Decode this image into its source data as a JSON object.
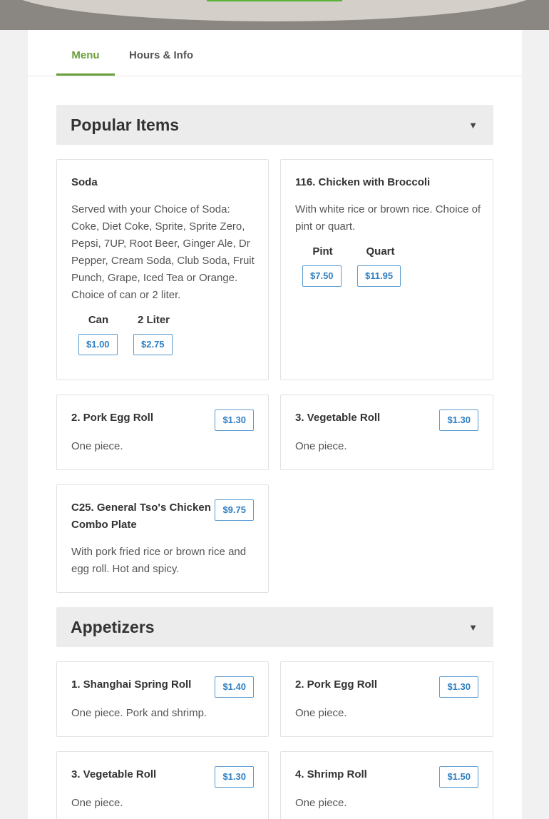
{
  "tabs": [
    {
      "label": "Menu",
      "active": true
    },
    {
      "label": "Hours & Info",
      "active": false
    }
  ],
  "sections": [
    {
      "title": "Popular Items",
      "items": [
        {
          "name": "Soda",
          "description": "Served with your Choice of Soda: Coke, Diet Coke, Sprite, Sprite Zero, Pepsi, 7UP, Root Beer, Ginger Ale, Dr Pepper, Cream Soda, Club Soda, Fruit Punch, Grape, Iced Tea or Orange. Choice of can or 2 liter.",
          "variants": [
            {
              "label": "Can",
              "price": "$1.00"
            },
            {
              "label": "2 Liter",
              "price": "$2.75"
            }
          ]
        },
        {
          "name": "116. Chicken with Broccoli",
          "description": "With white rice or brown rice. Choice of pint or quart.",
          "variants": [
            {
              "label": "Pint",
              "price": "$7.50"
            },
            {
              "label": "Quart",
              "price": "$11.95"
            }
          ]
        },
        {
          "name": "2. Pork Egg Roll",
          "description": "One piece.",
          "price": "$1.30"
        },
        {
          "name": "3. Vegetable Roll",
          "description": "One piece.",
          "price": "$1.30"
        },
        {
          "name": "C25. General Tso's Chicken Combo Plate",
          "description": "With pork fried rice or brown rice and egg roll. Hot and spicy.",
          "price": "$9.75"
        }
      ]
    },
    {
      "title": "Appetizers",
      "items": [
        {
          "name": "1. Shanghai Spring Roll",
          "description": "One piece. Pork and shrimp.",
          "price": "$1.40"
        },
        {
          "name": "2. Pork Egg Roll",
          "description": "One piece.",
          "price": "$1.30"
        },
        {
          "name": "3. Vegetable Roll",
          "description": "One piece.",
          "price": "$1.30"
        },
        {
          "name": "4. Shrimp Roll",
          "description": "One piece.",
          "price": "$1.50"
        }
      ]
    }
  ],
  "icons": {
    "section_toggle": "caret-down-icon"
  },
  "colors": {
    "accent": "#6a9e3c",
    "price_border": "#5b9bd0",
    "price_text": "#2f7fc1"
  }
}
